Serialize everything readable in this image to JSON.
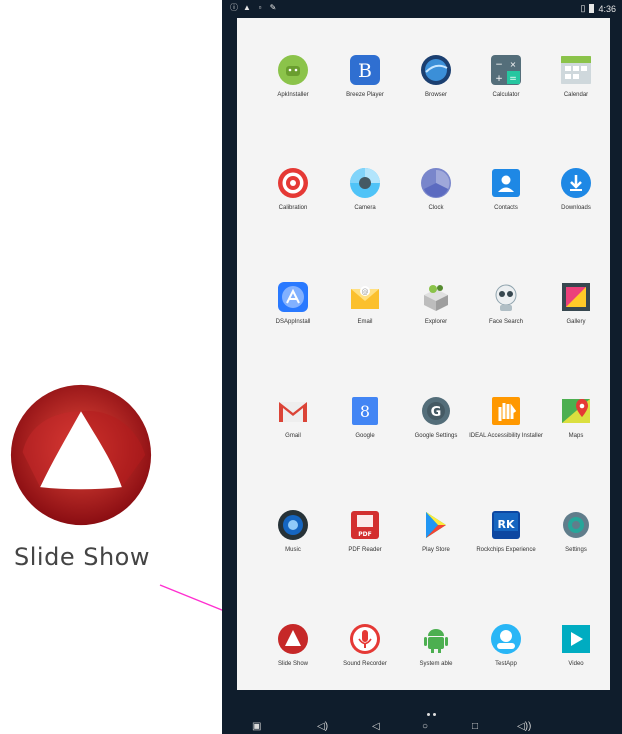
{
  "zoom": {
    "label": "Slide Show"
  },
  "statusbar": {
    "time": "4:36"
  },
  "apps": [
    {
      "label": "ApkInstaller",
      "icon": "android-installer-icon"
    },
    {
      "label": "Breeze Player",
      "icon": "breeze-player-icon"
    },
    {
      "label": "Browser",
      "icon": "browser-globe-icon"
    },
    {
      "label": "Calculator",
      "icon": "calculator-icon"
    },
    {
      "label": "Calendar",
      "icon": "calendar-icon"
    },
    {
      "label": "Calibration",
      "icon": "calibration-target-icon"
    },
    {
      "label": "Camera",
      "icon": "camera-icon"
    },
    {
      "label": "Clock",
      "icon": "clock-icon"
    },
    {
      "label": "Contacts",
      "icon": "contacts-icon"
    },
    {
      "label": "Downloads",
      "icon": "downloads-icon"
    },
    {
      "label": "DSAppInstall",
      "icon": "app-store-icon"
    },
    {
      "label": "Email",
      "icon": "email-envelope-icon"
    },
    {
      "label": "Explorer",
      "icon": "explorer-icon"
    },
    {
      "label": "Face Search",
      "icon": "face-search-icon"
    },
    {
      "label": "Gallery",
      "icon": "gallery-icon"
    },
    {
      "label": "Gmail",
      "icon": "gmail-icon"
    },
    {
      "label": "Google",
      "icon": "google-icon"
    },
    {
      "label": "Google Settings",
      "icon": "google-settings-icon"
    },
    {
      "label": "IDEAL Accessibility Installer",
      "icon": "accessibility-hand-icon"
    },
    {
      "label": "Maps",
      "icon": "maps-icon"
    },
    {
      "label": "Music",
      "icon": "music-speaker-icon"
    },
    {
      "label": "PDF Reader",
      "icon": "pdf-reader-icon"
    },
    {
      "label": "Play Store",
      "icon": "play-store-icon"
    },
    {
      "label": "Rockchips Experience",
      "icon": "rk-icon"
    },
    {
      "label": "Settings",
      "icon": "settings-gear-icon"
    },
    {
      "label": "Slide Show",
      "icon": "slide-show-icon"
    },
    {
      "label": "Sound Recorder",
      "icon": "microphone-icon"
    },
    {
      "label": "System able",
      "icon": "android-icon"
    },
    {
      "label": "TestApp",
      "icon": "test-app-icon"
    },
    {
      "label": "Video",
      "icon": "video-play-icon"
    }
  ]
}
